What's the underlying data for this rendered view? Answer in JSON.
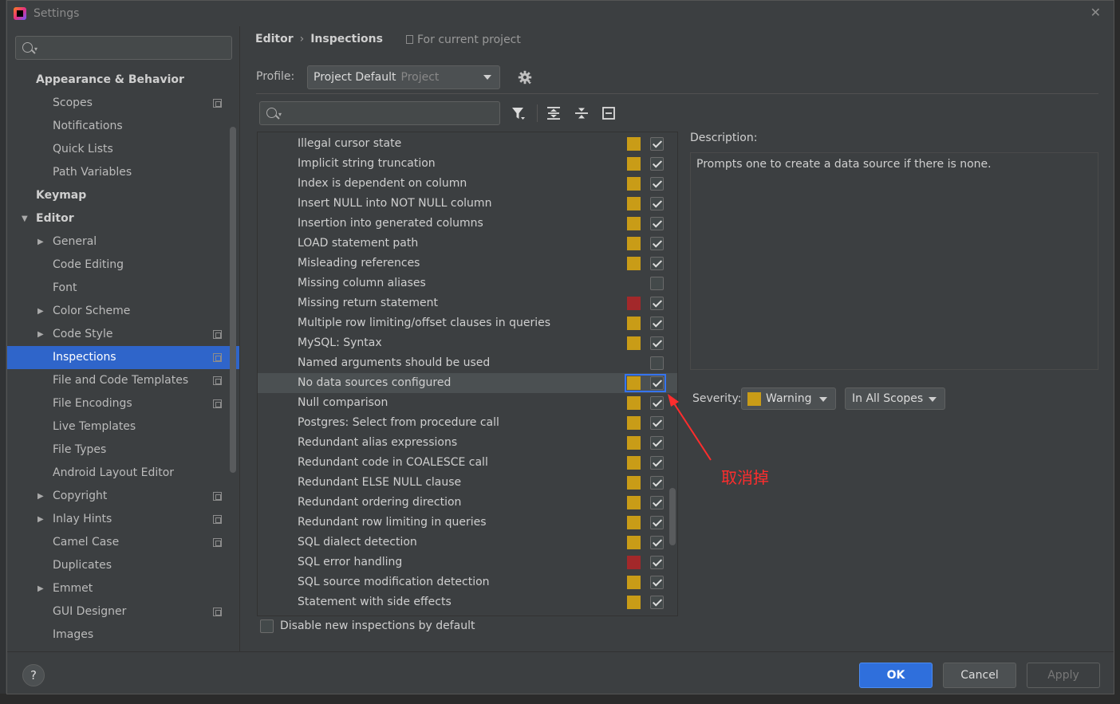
{
  "window": {
    "title": "Settings"
  },
  "colors": {
    "warning": "#c99c17",
    "error": "#a3282a",
    "selection": "#2f65ca",
    "annotation": "#ff2d2d"
  },
  "sidebar": {
    "items": [
      {
        "label": "Appearance & Behavior",
        "level": 0,
        "bold": true,
        "arrow": "",
        "copy": false
      },
      {
        "label": "Scopes",
        "level": 1,
        "bold": false,
        "arrow": "",
        "copy": true
      },
      {
        "label": "Notifications",
        "level": 1,
        "bold": false,
        "arrow": "",
        "copy": false
      },
      {
        "label": "Quick Lists",
        "level": 1,
        "bold": false,
        "arrow": "",
        "copy": false
      },
      {
        "label": "Path Variables",
        "level": 1,
        "bold": false,
        "arrow": "",
        "copy": false
      },
      {
        "label": "Keymap",
        "level": 0,
        "bold": true,
        "arrow": "",
        "copy": false
      },
      {
        "label": "Editor",
        "level": 0,
        "bold": true,
        "arrow": "expanded",
        "copy": false
      },
      {
        "label": "General",
        "level": 1,
        "bold": false,
        "arrow": "collapsed",
        "copy": false
      },
      {
        "label": "Code Editing",
        "level": 1,
        "bold": false,
        "arrow": "",
        "copy": false
      },
      {
        "label": "Font",
        "level": 1,
        "bold": false,
        "arrow": "",
        "copy": false
      },
      {
        "label": "Color Scheme",
        "level": 1,
        "bold": false,
        "arrow": "collapsed",
        "copy": false
      },
      {
        "label": "Code Style",
        "level": 1,
        "bold": false,
        "arrow": "collapsed",
        "copy": true
      },
      {
        "label": "Inspections",
        "level": 1,
        "bold": false,
        "arrow": "",
        "copy": true,
        "selected": true
      },
      {
        "label": "File and Code Templates",
        "level": 1,
        "bold": false,
        "arrow": "",
        "copy": true
      },
      {
        "label": "File Encodings",
        "level": 1,
        "bold": false,
        "arrow": "",
        "copy": true
      },
      {
        "label": "Live Templates",
        "level": 1,
        "bold": false,
        "arrow": "",
        "copy": false
      },
      {
        "label": "File Types",
        "level": 1,
        "bold": false,
        "arrow": "",
        "copy": false
      },
      {
        "label": "Android Layout Editor",
        "level": 1,
        "bold": false,
        "arrow": "",
        "copy": false
      },
      {
        "label": "Copyright",
        "level": 1,
        "bold": false,
        "arrow": "collapsed",
        "copy": true
      },
      {
        "label": "Inlay Hints",
        "level": 1,
        "bold": false,
        "arrow": "collapsed",
        "copy": true
      },
      {
        "label": "Camel Case",
        "level": 1,
        "bold": false,
        "arrow": "",
        "copy": true
      },
      {
        "label": "Duplicates",
        "level": 1,
        "bold": false,
        "arrow": "",
        "copy": false
      },
      {
        "label": "Emmet",
        "level": 1,
        "bold": false,
        "arrow": "collapsed",
        "copy": false
      },
      {
        "label": "GUI Designer",
        "level": 1,
        "bold": false,
        "arrow": "",
        "copy": true
      },
      {
        "label": "Images",
        "level": 1,
        "bold": false,
        "arrow": "",
        "copy": false
      }
    ]
  },
  "header": {
    "breadcrumb": [
      "Editor",
      "Inspections"
    ],
    "breadcrumb_sep": "›",
    "scope_note": "For current project"
  },
  "profile": {
    "label": "Profile:",
    "name": "Project Default",
    "sub": "Project"
  },
  "inspections": [
    {
      "name": "Illegal cursor state",
      "severity": "warning",
      "checked": true
    },
    {
      "name": "Implicit string truncation",
      "severity": "warning",
      "checked": true
    },
    {
      "name": "Index is dependent on column",
      "severity": "warning",
      "checked": true
    },
    {
      "name": "Insert NULL into NOT NULL column",
      "severity": "warning",
      "checked": true
    },
    {
      "name": "Insertion into generated columns",
      "severity": "warning",
      "checked": true
    },
    {
      "name": "LOAD statement path",
      "severity": "warning",
      "checked": true
    },
    {
      "name": "Misleading references",
      "severity": "warning",
      "checked": true
    },
    {
      "name": "Missing column aliases",
      "severity": "none",
      "checked": false
    },
    {
      "name": "Missing return statement",
      "severity": "error",
      "checked": true
    },
    {
      "name": "Multiple row limiting/offset clauses in queries",
      "severity": "warning",
      "checked": true
    },
    {
      "name": "MySQL: Syntax",
      "severity": "warning",
      "checked": true
    },
    {
      "name": "Named arguments should be used",
      "severity": "none",
      "checked": false
    },
    {
      "name": "No data sources configured",
      "severity": "warning",
      "checked": true,
      "selected": true
    },
    {
      "name": "Null comparison",
      "severity": "warning",
      "checked": true
    },
    {
      "name": "Postgres: Select from procedure call",
      "severity": "warning",
      "checked": true
    },
    {
      "name": "Redundant alias expressions",
      "severity": "warning",
      "checked": true
    },
    {
      "name": "Redundant code in COALESCE call",
      "severity": "warning",
      "checked": true
    },
    {
      "name": "Redundant ELSE NULL clause",
      "severity": "warning",
      "checked": true
    },
    {
      "name": "Redundant ordering direction",
      "severity": "warning",
      "checked": true
    },
    {
      "name": "Redundant row limiting in queries",
      "severity": "warning",
      "checked": true
    },
    {
      "name": "SQL dialect detection",
      "severity": "warning",
      "checked": true
    },
    {
      "name": "SQL error handling",
      "severity": "error",
      "checked": true
    },
    {
      "name": "SQL source modification detection",
      "severity": "warning",
      "checked": true
    },
    {
      "name": "Statement with side effects",
      "severity": "warning",
      "checked": true
    }
  ],
  "disable_new": {
    "label": "Disable new inspections by default",
    "checked": false
  },
  "description": {
    "label": "Description:",
    "text": "Prompts one to create a data source if there is none."
  },
  "severity": {
    "label": "Severity:",
    "value": "Warning",
    "scope": "In All Scopes"
  },
  "annotation": {
    "text": "取消掉"
  },
  "footer": {
    "help": "?",
    "ok": "OK",
    "cancel": "Cancel",
    "apply": "Apply"
  }
}
